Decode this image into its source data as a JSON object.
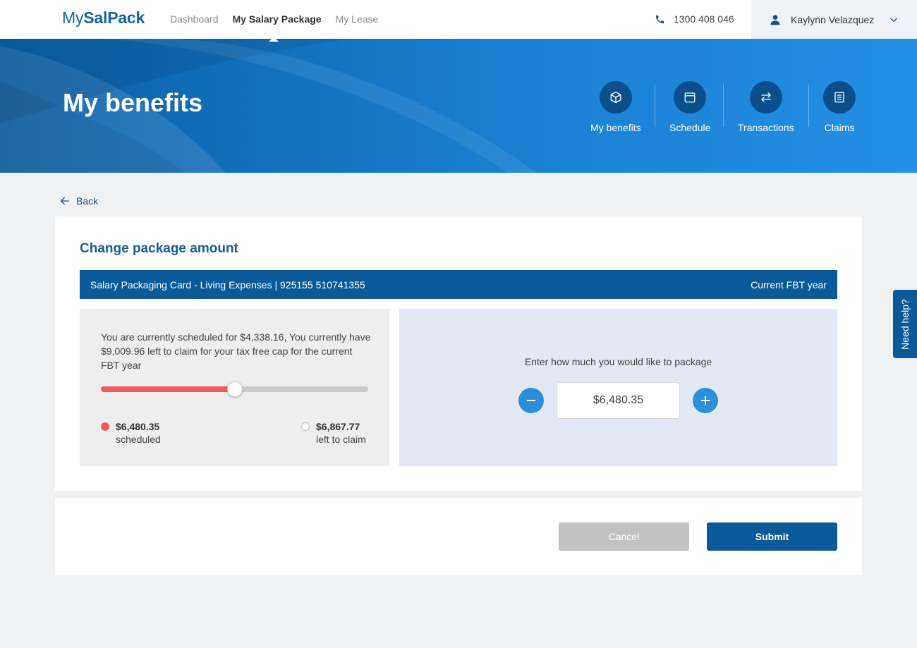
{
  "nav": {
    "logo_prefix": "My",
    "logo_main": "SalPack",
    "links": [
      {
        "label": "Dashboard",
        "active": false
      },
      {
        "label": "My Salary Package",
        "active": true
      },
      {
        "label": "My Lease",
        "active": false
      }
    ],
    "phone": "1300 408 046",
    "phone_icon": "phone-icon",
    "user_name": "Kaylynn Velazquez",
    "user_icon": "user-icon",
    "dropdown_icon": "chevron-down-icon"
  },
  "banner": {
    "title": "My benefits",
    "quick_links": [
      {
        "label": "My benefits",
        "icon": "box-icon"
      },
      {
        "label": "Schedule",
        "icon": "calendar-icon"
      },
      {
        "label": "Transactions",
        "icon": "transfer-icon"
      },
      {
        "label": "Claims",
        "icon": "receipt-icon"
      }
    ]
  },
  "back_label": "Back",
  "card": {
    "title": "Change package amount",
    "account": "Salary Packaging Card - Living Expenses | 925155 510741355",
    "fbt": "Current FBT year",
    "description": "You are currently scheduled for $4,338.16, You currently have $9,009.96 left to claim for your tax free cap for the current FBT year",
    "slider_fraction": 0.5,
    "scheduled_value": "$6,480.35",
    "scheduled_label": "scheduled",
    "left_value": "$6,867.77",
    "left_label": "left to claim",
    "enter_label": "Enter how much you would like to package",
    "amount": "$6,480.35"
  },
  "actions": {
    "cancel": "Cancel",
    "submit": "Submit"
  },
  "help": "Need help?",
  "colors": {
    "primary": "#0a5a9a",
    "accent": "#2a8fd8",
    "scheduled": "#f05a5a",
    "panel_blue": "#e3e9f4"
  }
}
